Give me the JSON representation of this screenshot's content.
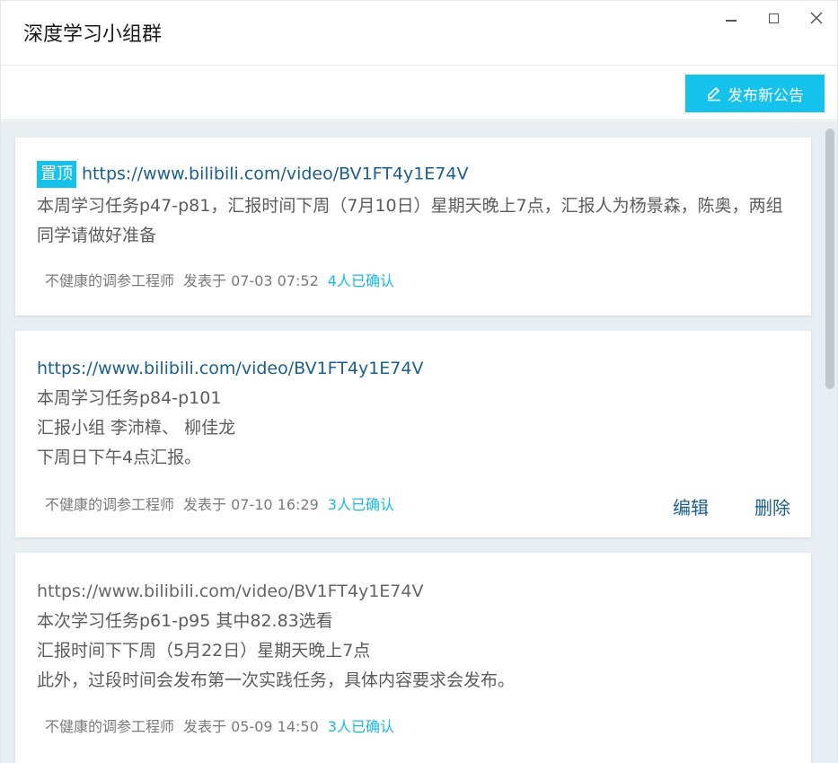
{
  "window": {
    "title": "深度学习小组群"
  },
  "toolbar": {
    "publish_label": "发布新公告"
  },
  "announcements": [
    {
      "pinned_label": "置顶",
      "link": "https://www.bilibili.com/video/BV1FT4y1E74V",
      "body": "本周学习任务p47-p81，汇报时间下周（7月10日）星期天晚上7点，汇报人为杨景森，陈奥，两组同学请做好准备",
      "author": "不健康的调参工程师",
      "posted": "发表于 07-03 07:52",
      "confirmed": "4人已确认"
    },
    {
      "link": "https://www.bilibili.com/video/BV1FT4y1E74V",
      "lines": [
        "本周学习任务p84-p101",
        "汇报小组 李沛樟、 柳佳龙",
        "下周日下午4点汇报。"
      ],
      "author": "不健康的调参工程师",
      "posted": "发表于 07-10 16:29",
      "confirmed": "3人已确认",
      "edit_label": "编辑",
      "delete_label": "删除"
    },
    {
      "link": "https://www.bilibili.com/video/BV1FT4y1E74V",
      "lines": [
        "本次学习任务p61-p95 其中82.83选看",
        "汇报时间下下周（5月22日）星期天晚上7点",
        "此外，过段时间会发布第一次实践任务，具体内容要求会发布。"
      ],
      "author": "不健康的调参工程师",
      "posted": "发表于 05-09 14:50",
      "confirmed": "3人已确认"
    }
  ],
  "colors": {
    "accent": "#14c2ec",
    "link": "#1b5f8f",
    "background": "#e9eef3"
  }
}
